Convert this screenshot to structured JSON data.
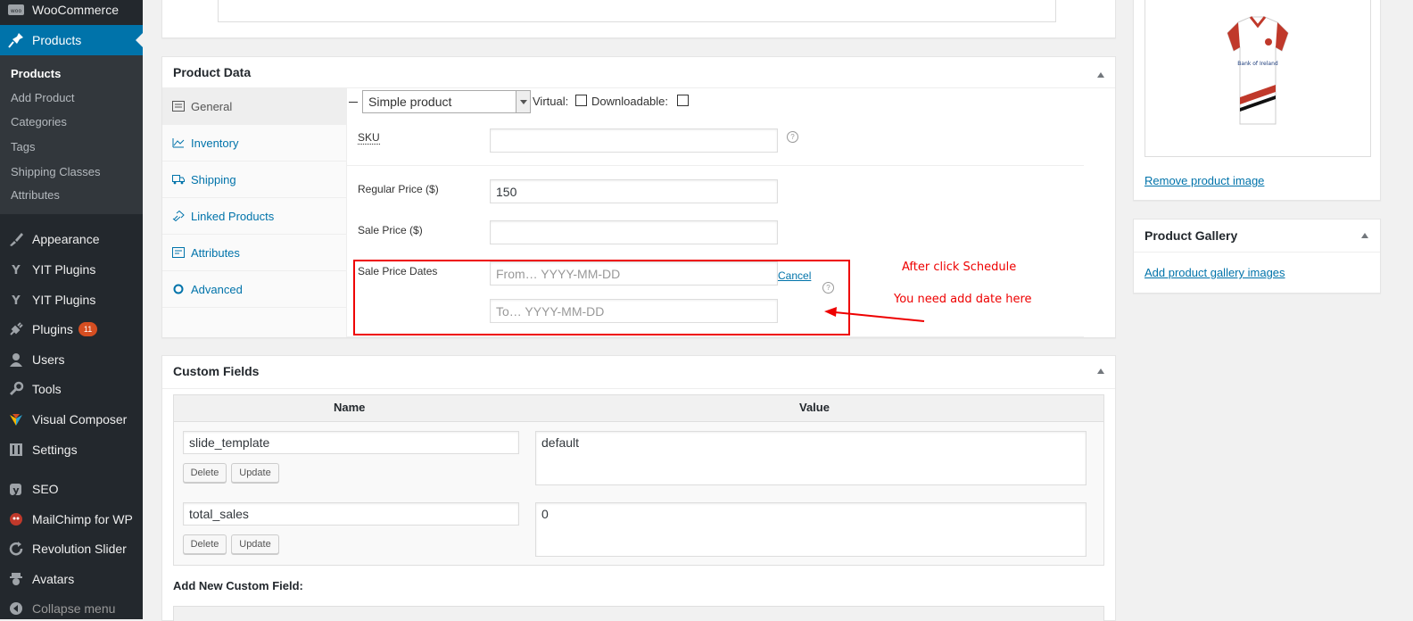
{
  "admin_menu": {
    "top_items": [
      {
        "label": "WooCommerce",
        "icon": "woo-icon"
      },
      {
        "label": "Products",
        "icon": "pin-icon"
      },
      {
        "label": "Appearance",
        "icon": "brush-icon"
      },
      {
        "label": "YIT Plugins",
        "icon": "yit-icon"
      },
      {
        "label": "YIT Plugins",
        "icon": "yit-icon"
      },
      {
        "label": "Plugins",
        "icon": "plug-icon",
        "badge": "11"
      },
      {
        "label": "Users",
        "icon": "user-icon"
      },
      {
        "label": "Tools",
        "icon": "wrench-icon"
      },
      {
        "label": "Visual Composer",
        "icon": "vc-icon"
      },
      {
        "label": "Settings",
        "icon": "settings-icon"
      },
      {
        "label": "SEO",
        "icon": "yoast-icon"
      },
      {
        "label": "MailChimp for WP",
        "icon": "mailchimp-icon"
      },
      {
        "label": "Revolution Slider",
        "icon": "refresh-icon"
      },
      {
        "label": "Avatars",
        "icon": "avatar-icon"
      },
      {
        "label": "Collapse menu",
        "icon": "collapse-icon"
      }
    ],
    "submenu": [
      "Products",
      "Add Product",
      "Categories",
      "Tags",
      "Shipping Classes",
      "Attributes"
    ]
  },
  "product_data": {
    "title": "Product Data",
    "product_type": "Simple product",
    "virtual_label": "Virtual:",
    "downloadable_label": "Downloadable:",
    "tabs": [
      {
        "label": "General",
        "icon": "general-icon"
      },
      {
        "label": "Inventory",
        "icon": "inventory-icon"
      },
      {
        "label": "Shipping",
        "icon": "truck-icon"
      },
      {
        "label": "Linked Products",
        "icon": "link-icon"
      },
      {
        "label": "Attributes",
        "icon": "attributes-icon"
      },
      {
        "label": "Advanced",
        "icon": "gear-icon"
      }
    ],
    "sku_label": "SKU",
    "sku_value": "",
    "regular_price_label": "Regular Price ($)",
    "regular_price_value": "150",
    "sale_price_label": "Sale Price ($)",
    "sale_price_value": "",
    "sale_dates_label": "Sale Price Dates",
    "from_placeholder": "From… YYYY-MM-DD",
    "to_placeholder": "To…  YYYY-MM-DD",
    "cancel_link": "Cancel",
    "help_glyph": "?"
  },
  "annotation": {
    "line1": "After click Schedule",
    "line2": "You need add date here",
    "color": "#e00000"
  },
  "custom_fields": {
    "title": "Custom Fields",
    "col_name": "Name",
    "col_value": "Value",
    "rows": [
      {
        "name": "slide_template",
        "value": "default"
      },
      {
        "name": "total_sales",
        "value": "0"
      }
    ],
    "delete_label": "Delete",
    "update_label": "Update",
    "add_new_label": "Add New Custom Field:"
  },
  "sidebar": {
    "remove_image_link": "Remove product image",
    "gallery_title": "Product Gallery",
    "add_gallery_link": "Add product gallery images",
    "jersey_logo_text": "Bank of Ireland"
  },
  "colors": {
    "menu_bg": "#23282d",
    "submenu_bg": "#32373c",
    "accent": "#0073aa",
    "badge": "#d54e21"
  }
}
